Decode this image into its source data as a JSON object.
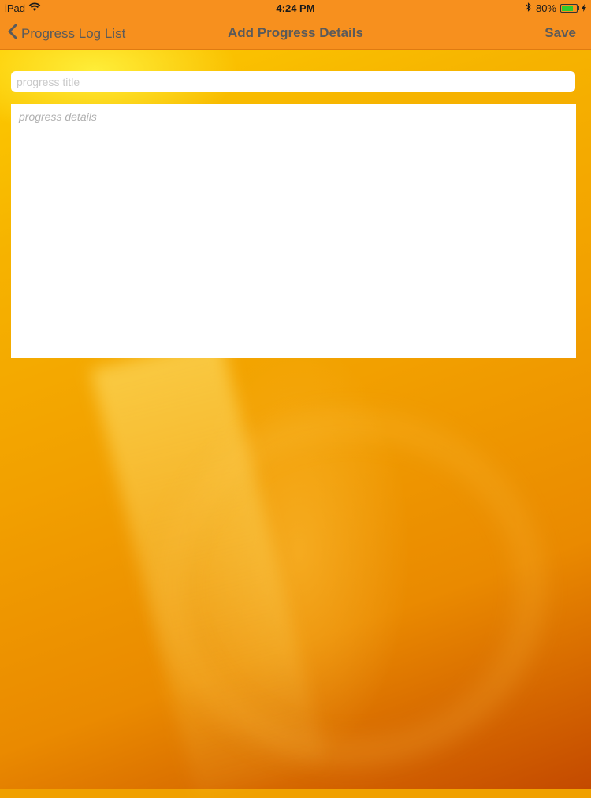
{
  "status_bar": {
    "device": "iPad",
    "time": "4:24 PM",
    "battery_percent": "80%",
    "battery_level": 0.8,
    "icons": [
      "wifi-icon",
      "bluetooth-icon",
      "battery-icon",
      "charging-bolt-icon"
    ]
  },
  "nav": {
    "back_label": "Progress Log List",
    "title": "Add Progress Details",
    "save_label": "Save"
  },
  "form": {
    "title_placeholder": "progress title",
    "title_value": "",
    "details_placeholder": "progress details",
    "details_value": ""
  },
  "colors": {
    "nav_background": "#f7901e",
    "nav_text": "#5a5a5a",
    "battery_fill": "#2ecc2e"
  }
}
